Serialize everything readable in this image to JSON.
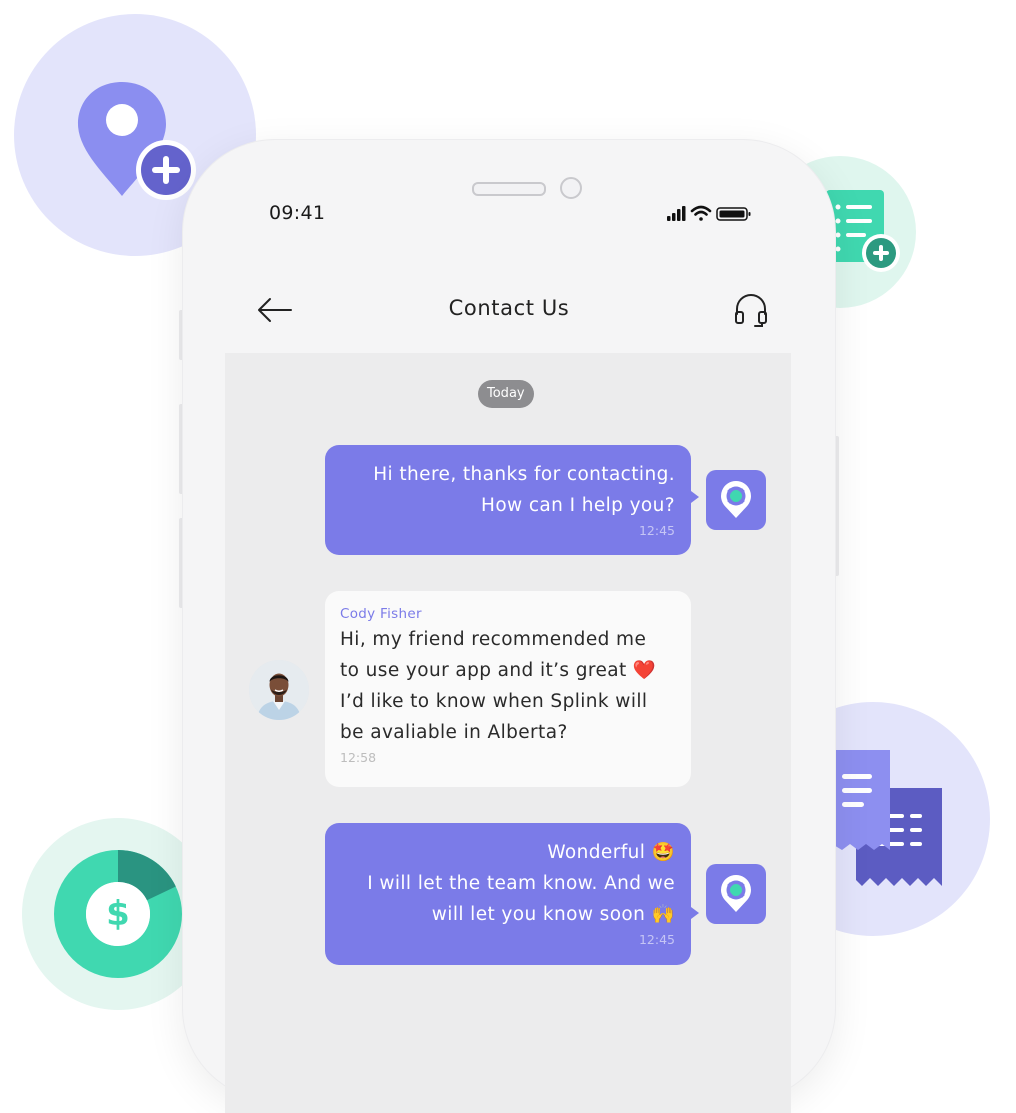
{
  "status_bar": {
    "time": "09:41"
  },
  "header": {
    "title": "Contact Us"
  },
  "chat": {
    "date_separator": "Today",
    "messages": [
      {
        "direction": "outgoing",
        "lines": [
          "Hi there, thanks for contacting.",
          "How can I help you?"
        ],
        "time": "12:45"
      },
      {
        "direction": "incoming",
        "sender": "Cody Fisher",
        "lines": [
          "Hi, my friend recommended me",
          "to use your app and it’s great ❤️",
          "I’d like to know when Splink will",
          "be avaliable in Alberta?"
        ],
        "time": "12:58"
      },
      {
        "direction": "outgoing",
        "lines": [
          "Wonderful 🤩",
          "I will let the team know. And we",
          "will let you know soon 🙌"
        ],
        "time": "12:45"
      }
    ]
  },
  "decorations": {
    "icons": [
      "location-add-icon",
      "checklist-add-icon",
      "receipt-icon",
      "dollar-donut-icon"
    ],
    "dollar_symbol": "$"
  },
  "colors": {
    "accent": "#7b7be8",
    "accent_dark": "#6161c9",
    "teal": "#3fd3b0",
    "teal_dark": "#279a82",
    "chat_bg": "#ececed",
    "incoming_bubble": "#fafafa"
  }
}
